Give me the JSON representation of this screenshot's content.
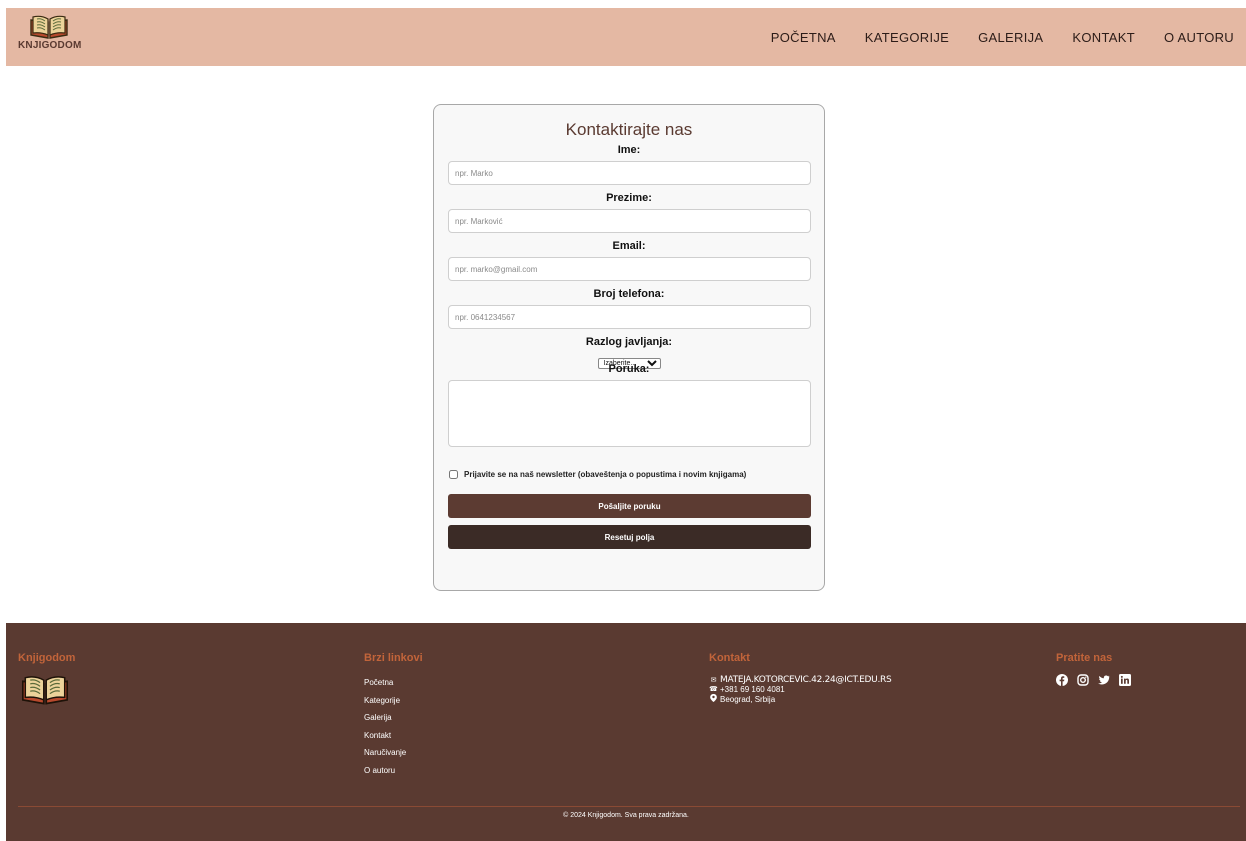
{
  "header": {
    "brand": "KNJIGODOM",
    "nav": [
      "POČETNA",
      "KATEGORIJE",
      "GALERIJA",
      "KONTAKT",
      "O AUTORU"
    ]
  },
  "form": {
    "title": "Kontaktirajte nas",
    "fields": {
      "first_name": {
        "label": "Ime:",
        "placeholder": "npr. Marko",
        "value": ""
      },
      "last_name": {
        "label": "Prezime:",
        "placeholder": "npr. Marković",
        "value": ""
      },
      "email": {
        "label": "Email:",
        "placeholder": "npr. marko@gmail.com",
        "value": ""
      },
      "phone": {
        "label": "Broj telefona:",
        "placeholder": "npr. 0641234567",
        "value": ""
      }
    },
    "reason": {
      "label": "Razlog javljanja:",
      "selected": "Izaberite..."
    },
    "message": {
      "label": "Poruka:",
      "value": ""
    },
    "newsletter": {
      "label": "Prijavite se na naš newsletter (obaveštenja o popustima i novim knjigama)",
      "checked": false
    },
    "send_label": "Pošaljite poruku",
    "reset_label": "Resetuj polja"
  },
  "footer": {
    "brand": {
      "title": "Knjigodom"
    },
    "links": {
      "title": "Brzi linkovi",
      "items": [
        "Početna",
        "Kategorije",
        "Galerija",
        "Kontakt",
        "Naručivanje",
        "O autoru"
      ]
    },
    "contact": {
      "title": "Kontakt",
      "email": "MATEJA.KOTORCEVIC.42.24@ICT.EDU.RS",
      "phone": "+381 69 160 4081",
      "address": "Beograd, Srbija"
    },
    "social": {
      "title": "Pratite nas",
      "icons": [
        "facebook-icon",
        "instagram-icon",
        "twitter-icon",
        "linkedin-icon"
      ]
    },
    "copyright": "© 2024 Knjigodom. Sva prava zadržana."
  },
  "colors": {
    "header_bg": "#e4b8a3",
    "footer_bg": "#5a3a31",
    "accent": "#c2643a",
    "button_primary": "#5c3b32",
    "button_secondary": "#3b2b26"
  }
}
